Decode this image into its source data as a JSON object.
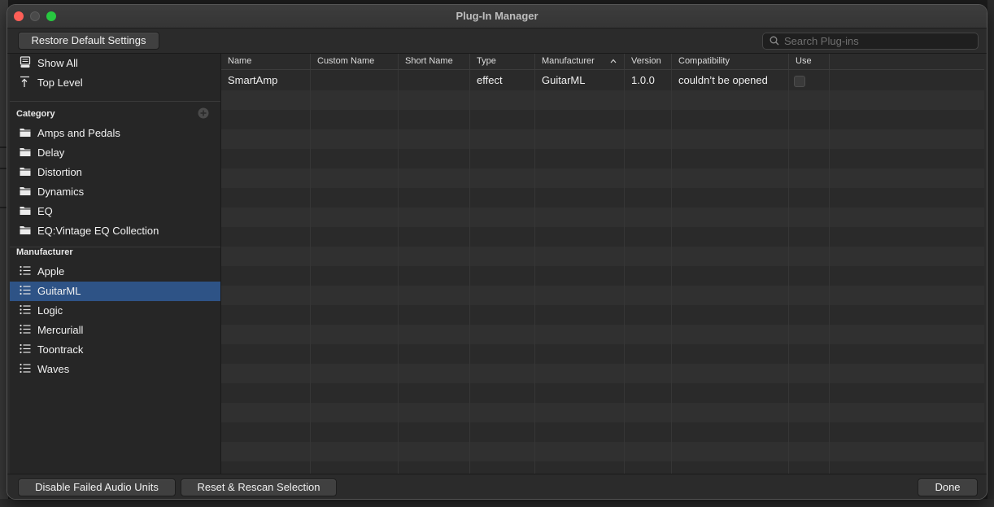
{
  "window": {
    "title": "Plug-In Manager"
  },
  "toolbar": {
    "restore_label": "Restore Default Settings",
    "search_placeholder": "Search Plug-ins"
  },
  "sidebar": {
    "show_all": "Show All",
    "top_level": "Top Level",
    "category_header": "Category",
    "categories": [
      "Amps and Pedals",
      "Delay",
      "Distortion",
      "Dynamics",
      "EQ",
      "EQ:Vintage EQ Collection"
    ],
    "manufacturer_header": "Manufacturer",
    "manufacturers": [
      "Apple",
      "GuitarML",
      "Logic",
      "Mercuriall",
      "Toontrack",
      "Waves"
    ],
    "selected_manufacturer": "GuitarML"
  },
  "table": {
    "columns": [
      "Name",
      "Custom Name",
      "Short Name",
      "Type",
      "Manufacturer",
      "Version",
      "Compatibility",
      "Use"
    ],
    "sort_column": "Manufacturer",
    "rows": [
      {
        "name": "SmartAmp",
        "custom_name": "",
        "short_name": "",
        "type": "effect",
        "manufacturer": "GuitarML",
        "version": "1.0.0",
        "compatibility": "couldn’t be opened",
        "use": false
      }
    ]
  },
  "footer": {
    "disable_failed_label": "Disable Failed Audio Units",
    "reset_rescan_label": "Reset & Rescan Selection",
    "done_label": "Done"
  },
  "colors": {
    "selection": "#2e5386",
    "close": "#fe5f57",
    "maximize": "#28c840",
    "window_bg": "#2b2b2b"
  }
}
